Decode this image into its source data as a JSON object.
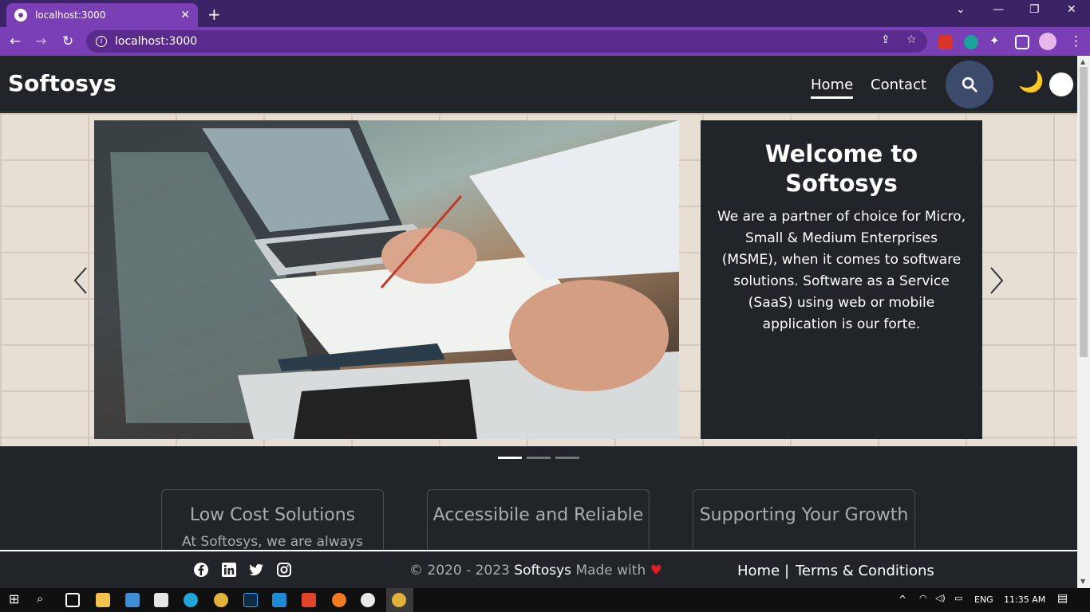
{
  "browser": {
    "tab_title": "localhost:3000",
    "url": "localhost:3000"
  },
  "site": {
    "brand": "Softosys",
    "nav": [
      {
        "label": "Home",
        "active": true
      },
      {
        "label": "Contact",
        "active": false
      }
    ]
  },
  "hero": {
    "title": "Welcome to Softosys",
    "text": "We are a partner of choice for Micro, Small & Medium Enterprises (MSME), when it comes to software solutions. Software as a Service (SaaS) using web or mobile application is our forte."
  },
  "features": [
    {
      "title": "Low Cost Solutions",
      "text": "At Softosys, we are always"
    },
    {
      "title": "Accessibile and Reliable",
      "text": ""
    },
    {
      "title": "Supporting Your Growth",
      "text": ""
    }
  ],
  "footer": {
    "copy_prefix": "© 2020 - 2023",
    "brand": "Softosys",
    "made_with": "Made with",
    "heart": "♥",
    "links": [
      "Home",
      "Terms & Conditions"
    ],
    "separator": "|"
  },
  "taskbar": {
    "lang": "ENG",
    "time": "11:35 AM"
  },
  "colors": {
    "browser_accent": "#7a3fb5",
    "page_bg": "#212529",
    "search_btn": "#3c4a6b",
    "heart": "#e21b1b"
  }
}
